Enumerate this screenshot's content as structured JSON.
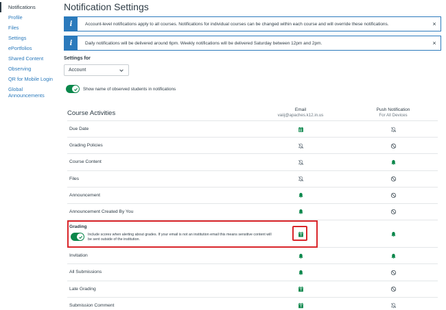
{
  "sidebar": {
    "items": [
      {
        "label": "Notifications",
        "active": true
      },
      {
        "label": "Profile"
      },
      {
        "label": "Files"
      },
      {
        "label": "Settings"
      },
      {
        "label": "ePortfolios"
      },
      {
        "label": "Shared Content"
      },
      {
        "label": "Observing"
      },
      {
        "label": "QR for Mobile Login"
      },
      {
        "label": "Global Announcements"
      }
    ]
  },
  "page": {
    "title": "Notification Settings"
  },
  "alerts": [
    {
      "message": "Account-level notifications apply to all courses. Notifications for individual courses can be changed within each course and will override these notifications.",
      "close": "×"
    },
    {
      "message": "Daily notifications will be delivered around 6pm. Weekly notifications will be delivered Saturday between 12pm and 2pm.",
      "close": "×"
    }
  ],
  "settings_for": {
    "label": "Settings for",
    "value": "Account"
  },
  "observed_toggle": {
    "label": "Show name of observed students in notifications",
    "on": true
  },
  "table": {
    "title": "Course Activities",
    "email_header": "Email",
    "email_address": "vaiij@apaches.k12.in.us",
    "push_header": "Push Notification",
    "push_sub": "For All Devices",
    "rows": [
      {
        "name": "Due Date",
        "email": "calendar-weekly",
        "push": "bell-off"
      },
      {
        "name": "Grading Policies",
        "email": "bell-off",
        "push": "blocked"
      },
      {
        "name": "Course Content",
        "email": "bell-off",
        "push": "bell-on"
      },
      {
        "name": "Files",
        "email": "bell-off",
        "push": "blocked"
      },
      {
        "name": "Announcement",
        "email": "bell-on",
        "push": "blocked"
      },
      {
        "name": "Announcement Created By You",
        "email": "bell-on",
        "push": "blocked"
      },
      {
        "name": "Grading",
        "email": "calendar-daily",
        "push": "bell-on"
      },
      {
        "name": "Invitation",
        "email": "bell-on",
        "push": "bell-on"
      },
      {
        "name": "All Submissions",
        "email": "bell-on",
        "push": "blocked"
      },
      {
        "name": "Late Grading",
        "email": "calendar-daily",
        "push": "blocked"
      },
      {
        "name": "Submission Comment",
        "email": "calendar-daily",
        "push": "bell-off"
      }
    ],
    "grading_option": "Include scores when alerting about grades. If your email is not an institution email this means sensitive content will be sent outside of the institution."
  },
  "colors": {
    "accent": "#2b7abc",
    "success": "#0b874b",
    "highlight": "#d9252a",
    "text": "#2d3b45"
  }
}
